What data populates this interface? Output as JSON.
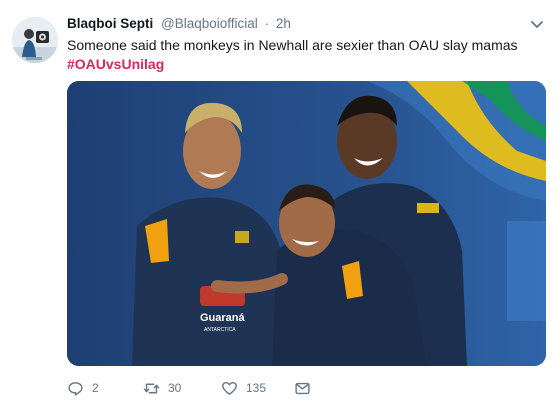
{
  "author": {
    "display_name": "Blaqboi Septi",
    "handle": "@Blaqboiofficial",
    "separator": "·",
    "time": "2h"
  },
  "tweet": {
    "text": "Someone said the monkeys in Newhall are sexier than OAU slay mamas",
    "hashtag": "#OAUvsUnilag",
    "media": {
      "jersey_sponsor": "Guaraná",
      "jersey_sponsor_sub": "ANTARCTICA",
      "background_colors": [
        "#24477e",
        "#2e5c9c",
        "#f1c40f",
        "#009c3b"
      ]
    }
  },
  "actions": {
    "reply": {
      "icon": "reply-icon",
      "count": "2"
    },
    "retweet": {
      "icon": "retweet-icon",
      "count": "30"
    },
    "like": {
      "icon": "heart-icon",
      "count": "135"
    },
    "dm": {
      "icon": "envelope-icon"
    }
  },
  "colors": {
    "hashtag": "#e0245e",
    "secondary_text": "#657786",
    "primary_text": "#14171a"
  }
}
